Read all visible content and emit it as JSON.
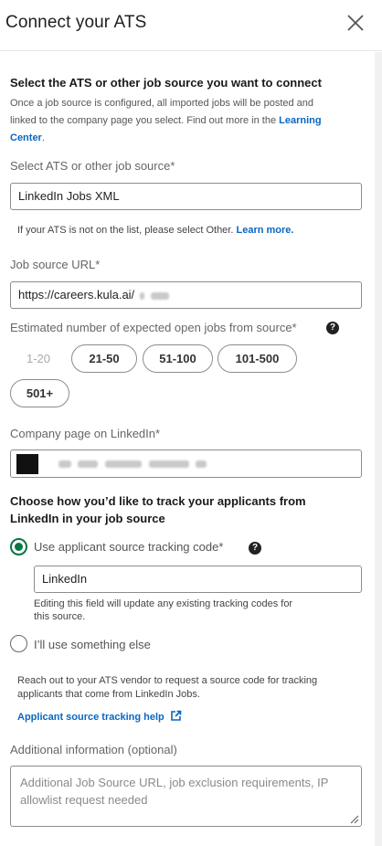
{
  "header": {
    "title": "Connect your ATS"
  },
  "intro": {
    "heading": "Select the ATS or other job source you want to connect",
    "line1": "Once a job source is configured, all imported jobs will be posted and",
    "line2_text": "linked to the company page you select. Find out more in the ",
    "line2_link": "Learning",
    "line3_link": "Center",
    "line3_end": "."
  },
  "ats": {
    "label": "Select ATS or other job source*",
    "value": "LinkedIn Jobs XML",
    "note_text": "If your ATS is not on the list, please select Other. ",
    "note_link": "Learn more."
  },
  "url": {
    "label": "Job source URL*",
    "value": "https://careers.kula.ai/"
  },
  "jobs": {
    "label": "Estimated number of expected open jobs from source*",
    "options": [
      "1-20",
      "21-50",
      "51-100",
      "101-500",
      "501+"
    ]
  },
  "company": {
    "label": "Company page on LinkedIn*"
  },
  "tracking": {
    "heading_line1": "Choose how you’d like to track your applicants from",
    "heading_line2": "LinkedIn in your job source",
    "option1": "Use applicant source tracking code*",
    "code_value": "LinkedIn",
    "code_note_line1": "Editing this field will update any existing tracking codes for",
    "code_note_line2": "this source.",
    "option2": "I’ll use something else",
    "vendor_line1": "Reach out to your ATS vendor to request a source code for tracking",
    "vendor_line2": "applicants that come from LinkedIn Jobs.",
    "help_link": "Applicant source tracking help"
  },
  "additional": {
    "label": "Additional information (optional)",
    "placeholder_line1": "Additional Job Source URL, job exclusion requirements, IP",
    "placeholder_line2": "allowlist request needed"
  },
  "colors": {
    "accent": "#0a66c2",
    "radio_selected": "#057642"
  },
  "icons": [
    "close-icon",
    "help-icon",
    "external-link-icon",
    "resize-grip-icon"
  ]
}
